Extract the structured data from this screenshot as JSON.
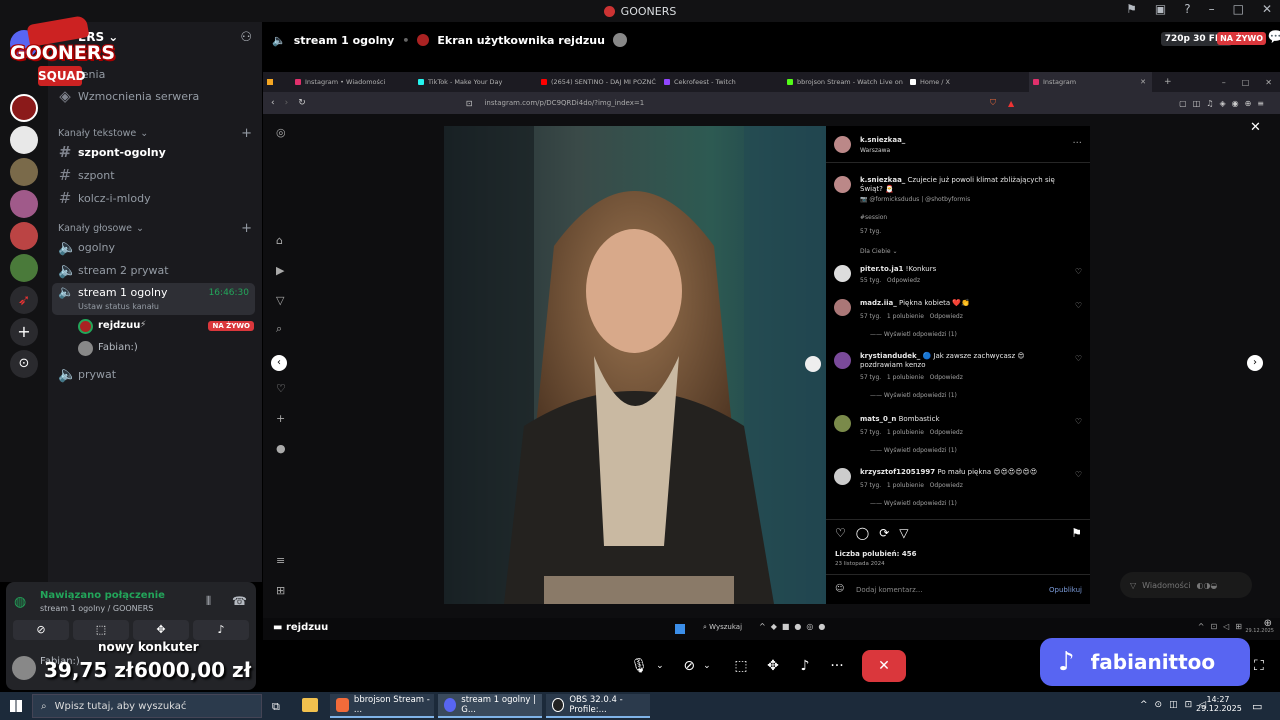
{
  "window": {
    "title": "GOONERS"
  },
  "server": {
    "name": "GOONERS",
    "logo_line1": "GOONERS",
    "logo_line2": "SQUAD",
    "partial_name": "ERS"
  },
  "sidebar": {
    "top_items": [
      {
        "label": "Wydarzenia",
        "visible_text": "zenia"
      },
      {
        "label": "Wzmocnienia serwera"
      }
    ],
    "text_category": "Kanały tekstowe",
    "text_channels": [
      {
        "label": "szpont-ogolny",
        "active": true
      },
      {
        "label": "szpont"
      },
      {
        "label": "kolcz-i-mlody"
      }
    ],
    "voice_category": "Kanały głosowe",
    "voice_channels": [
      {
        "label": "ogolny"
      },
      {
        "label": "stream 2 prywat"
      },
      {
        "label": "stream 1 ogolny",
        "time": "16:46:30",
        "status": "Ustaw status kanału"
      },
      {
        "label": "prywat"
      }
    ],
    "voice_users": [
      {
        "name": "rejdzuu",
        "badge": "NA ŻYWO"
      },
      {
        "name": "Fabian:)"
      }
    ]
  },
  "header": {
    "channel": "stream 1 ogolny",
    "screen_label": "Ekran użytkownika rejdzuu",
    "quality": "720p 30 FPS",
    "live": "NA ŻYWO"
  },
  "browser": {
    "tabs": [
      "Instagram • Wiadomości",
      "TikTok - Make Your Day",
      "(2654) SENTINO - DAJ MI POZNĆ",
      "Cekrofeest - Twitch",
      "bbrojson Stream - Watch Live on",
      "Home / X",
      "Instagram"
    ],
    "tab_colors": [
      "#e1306c",
      "#25f4ee",
      "#ff0000",
      "#9146ff",
      "#53fc18",
      "#ffffff",
      "#e1306c"
    ],
    "url": "instagram.com/p/DC9QRDi4do/?img_index=1"
  },
  "post": {
    "author": "k.sniezkaa_",
    "location": "Warszawa",
    "caption_user": "k.sniezkaa_",
    "caption": "Czujecie już powoli klimat zbliżających się Świąt? 🎅",
    "tags": "📷 @formicksdudus | @shotbyformis",
    "hashtag": "#session",
    "caption_time": "57 tyg.",
    "for_you": "Dla Ciebie",
    "comments": [
      {
        "user": "piter.to.ja1",
        "text": "!Konkurs",
        "time": "55 tyg.",
        "likes": "",
        "reply": "Odpowiedz",
        "view": ""
      },
      {
        "user": "madz.iia_",
        "text": "Piękna kobieta ❤️👏",
        "time": "57 tyg.",
        "likes": "1 polubienie",
        "reply": "Odpowiedz",
        "view": "Wyświetl odpowiedzi (1)"
      },
      {
        "user": "krystiandudek_",
        "text": "🔵 Jak zawsze zachwycasz 😍 pozdrawiam kenzo",
        "time": "57 tyg.",
        "likes": "1 polubienie",
        "reply": "Odpowiedz",
        "view": "Wyświetl odpowiedzi (1)"
      },
      {
        "user": "mats_0_n",
        "text": "Bombastick",
        "time": "57 tyg.",
        "likes": "1 polubienie",
        "reply": "Odpowiedz",
        "view": "Wyświetl odpowiedzi (1)"
      },
      {
        "user": "krzysztof12051997",
        "text": "Po mału piękna 😍😍😍😍😍😍",
        "time": "57 tyg.",
        "likes": "1 polubienie",
        "reply": "Odpowiedz",
        "view": "Wyświetl odpowiedzi (1)"
      }
    ],
    "likes_label": "Liczba polubień: 456",
    "date": "23 listopada 2024",
    "comment_placeholder": "Dodaj komentarz...",
    "publish": "Opublikuj",
    "messages": "Wiadomości"
  },
  "stream_footer": {
    "streamer": "rejdzuu",
    "search": "Wyszukaj",
    "date": "29.12.2025"
  },
  "voice_panel": {
    "status": "Nawiązano połączenie",
    "channel": "stream 1 ogolny / GOONERS",
    "user": "Fabian:)"
  },
  "overlay": {
    "konkurs": "nowy konkuter",
    "amount1": "39,75 zł",
    "amount2": "6000,00 zł",
    "tiktok": "fabianittoo"
  },
  "taskbar": {
    "search": "Wpisz tutaj, aby wyszukać",
    "items": [
      "bbrojson Stream - ...",
      "stream 1 ogolny | G...",
      "OBS 32.0.4 - Profile:..."
    ],
    "time": "14:27",
    "date": "29.12.2025"
  }
}
